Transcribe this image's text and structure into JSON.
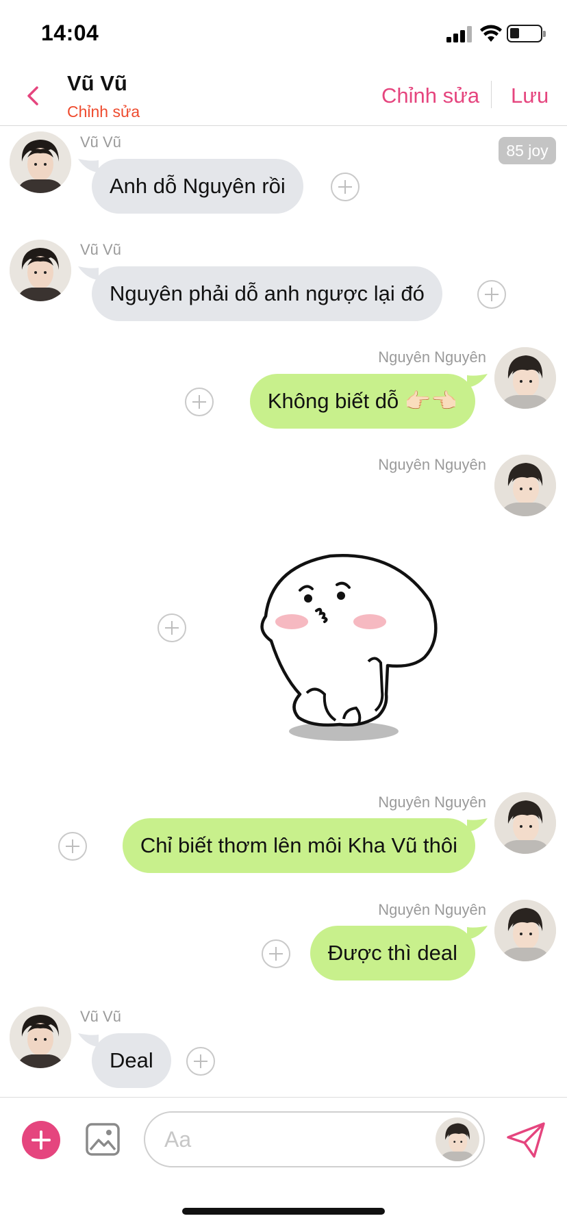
{
  "status_bar": {
    "time": "14:04"
  },
  "header": {
    "contact_name": "Vũ Vũ",
    "subtitle": "Chỉnh sửa",
    "edit_label": "Chỉnh sửa",
    "save_label": "Lưu",
    "accent_color": "#e5457e"
  },
  "joy_badge": "85 joy",
  "messages": [
    {
      "sender": "Vũ Vũ",
      "side": "left",
      "text": "Anh dỗ Nguyên rồi"
    },
    {
      "sender": "Vũ Vũ",
      "side": "left",
      "text": "Nguyên phải dỗ anh ngược lại đó"
    },
    {
      "sender": "Nguyên Nguyên",
      "side": "right",
      "text": "Không biết dỗ 👉🏻👈🏻"
    },
    {
      "sender": "Nguyên Nguyên",
      "side": "right",
      "type": "sticker",
      "sticker": "pouting-mochi-sticker"
    },
    {
      "sender": "Nguyên Nguyên",
      "side": "right",
      "text": "Chỉ biết thơm lên môi Kha Vũ thôi"
    },
    {
      "sender": "Nguyên Nguyên",
      "side": "right",
      "text": "Được thì deal"
    },
    {
      "sender": "Vũ Vũ",
      "side": "left",
      "text": "Deal"
    }
  ],
  "composer": {
    "placeholder": "Aa"
  },
  "icons": {
    "back": "chevron-left-icon",
    "add": "plus-icon",
    "gallery": "image-icon",
    "send": "paper-plane-icon",
    "reaction": "add-reaction-icon"
  },
  "colors": {
    "left_bubble": "#e4e6ea",
    "right_bubble": "#c8f08c",
    "subtitle": "#ee4a2d"
  }
}
